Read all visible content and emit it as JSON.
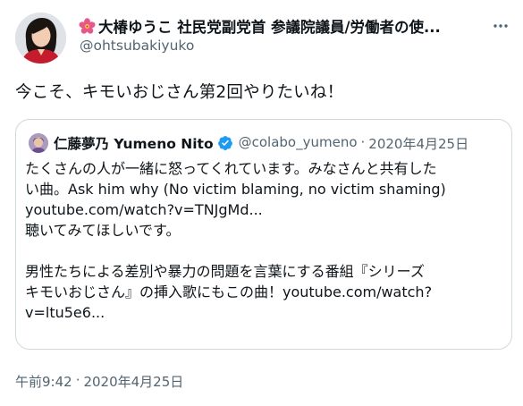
{
  "author": {
    "display_name": "大椿ゆうこ 社民党副党首 参議院議員/労働者の使...",
    "handle": "@ohtsubakiyuko",
    "name_emoji_icon": "hibiscus-flower-icon"
  },
  "tweet": {
    "text": "今こそ、キモいおじさん第2回やりたいね！",
    "time": "午前9:42",
    "separator": "·",
    "date": "2020年4月25日"
  },
  "quoted_tweet": {
    "display_name": "仁藤夢乃 Yumeno Nito",
    "verified": true,
    "handle": "@colabo_yumeno",
    "separator": "·",
    "date": "2020年4月25日",
    "lines": [
      "たくさんの人が一緒に怒ってくれています。みなさんと共有した",
      "い曲。Ask him why (No victim blaming, no victim shaming)",
      "youtube.com/watch?v=TNJgMd...",
      "聴いてみてほしいです。",
      "",
      "男性たちによる差別や暴力の問題を言葉にする番組『シリーズ",
      "キモいおじさん』の挿入歌にもこの曲！youtube.com/watch?",
      "v=ltu5e6..."
    ]
  },
  "colors": {
    "text_primary": "#0f1419",
    "text_secondary": "#536471",
    "border": "#cfd9de",
    "verified_blue": "#1d9bf0",
    "flower_pink": "#e8578a"
  }
}
